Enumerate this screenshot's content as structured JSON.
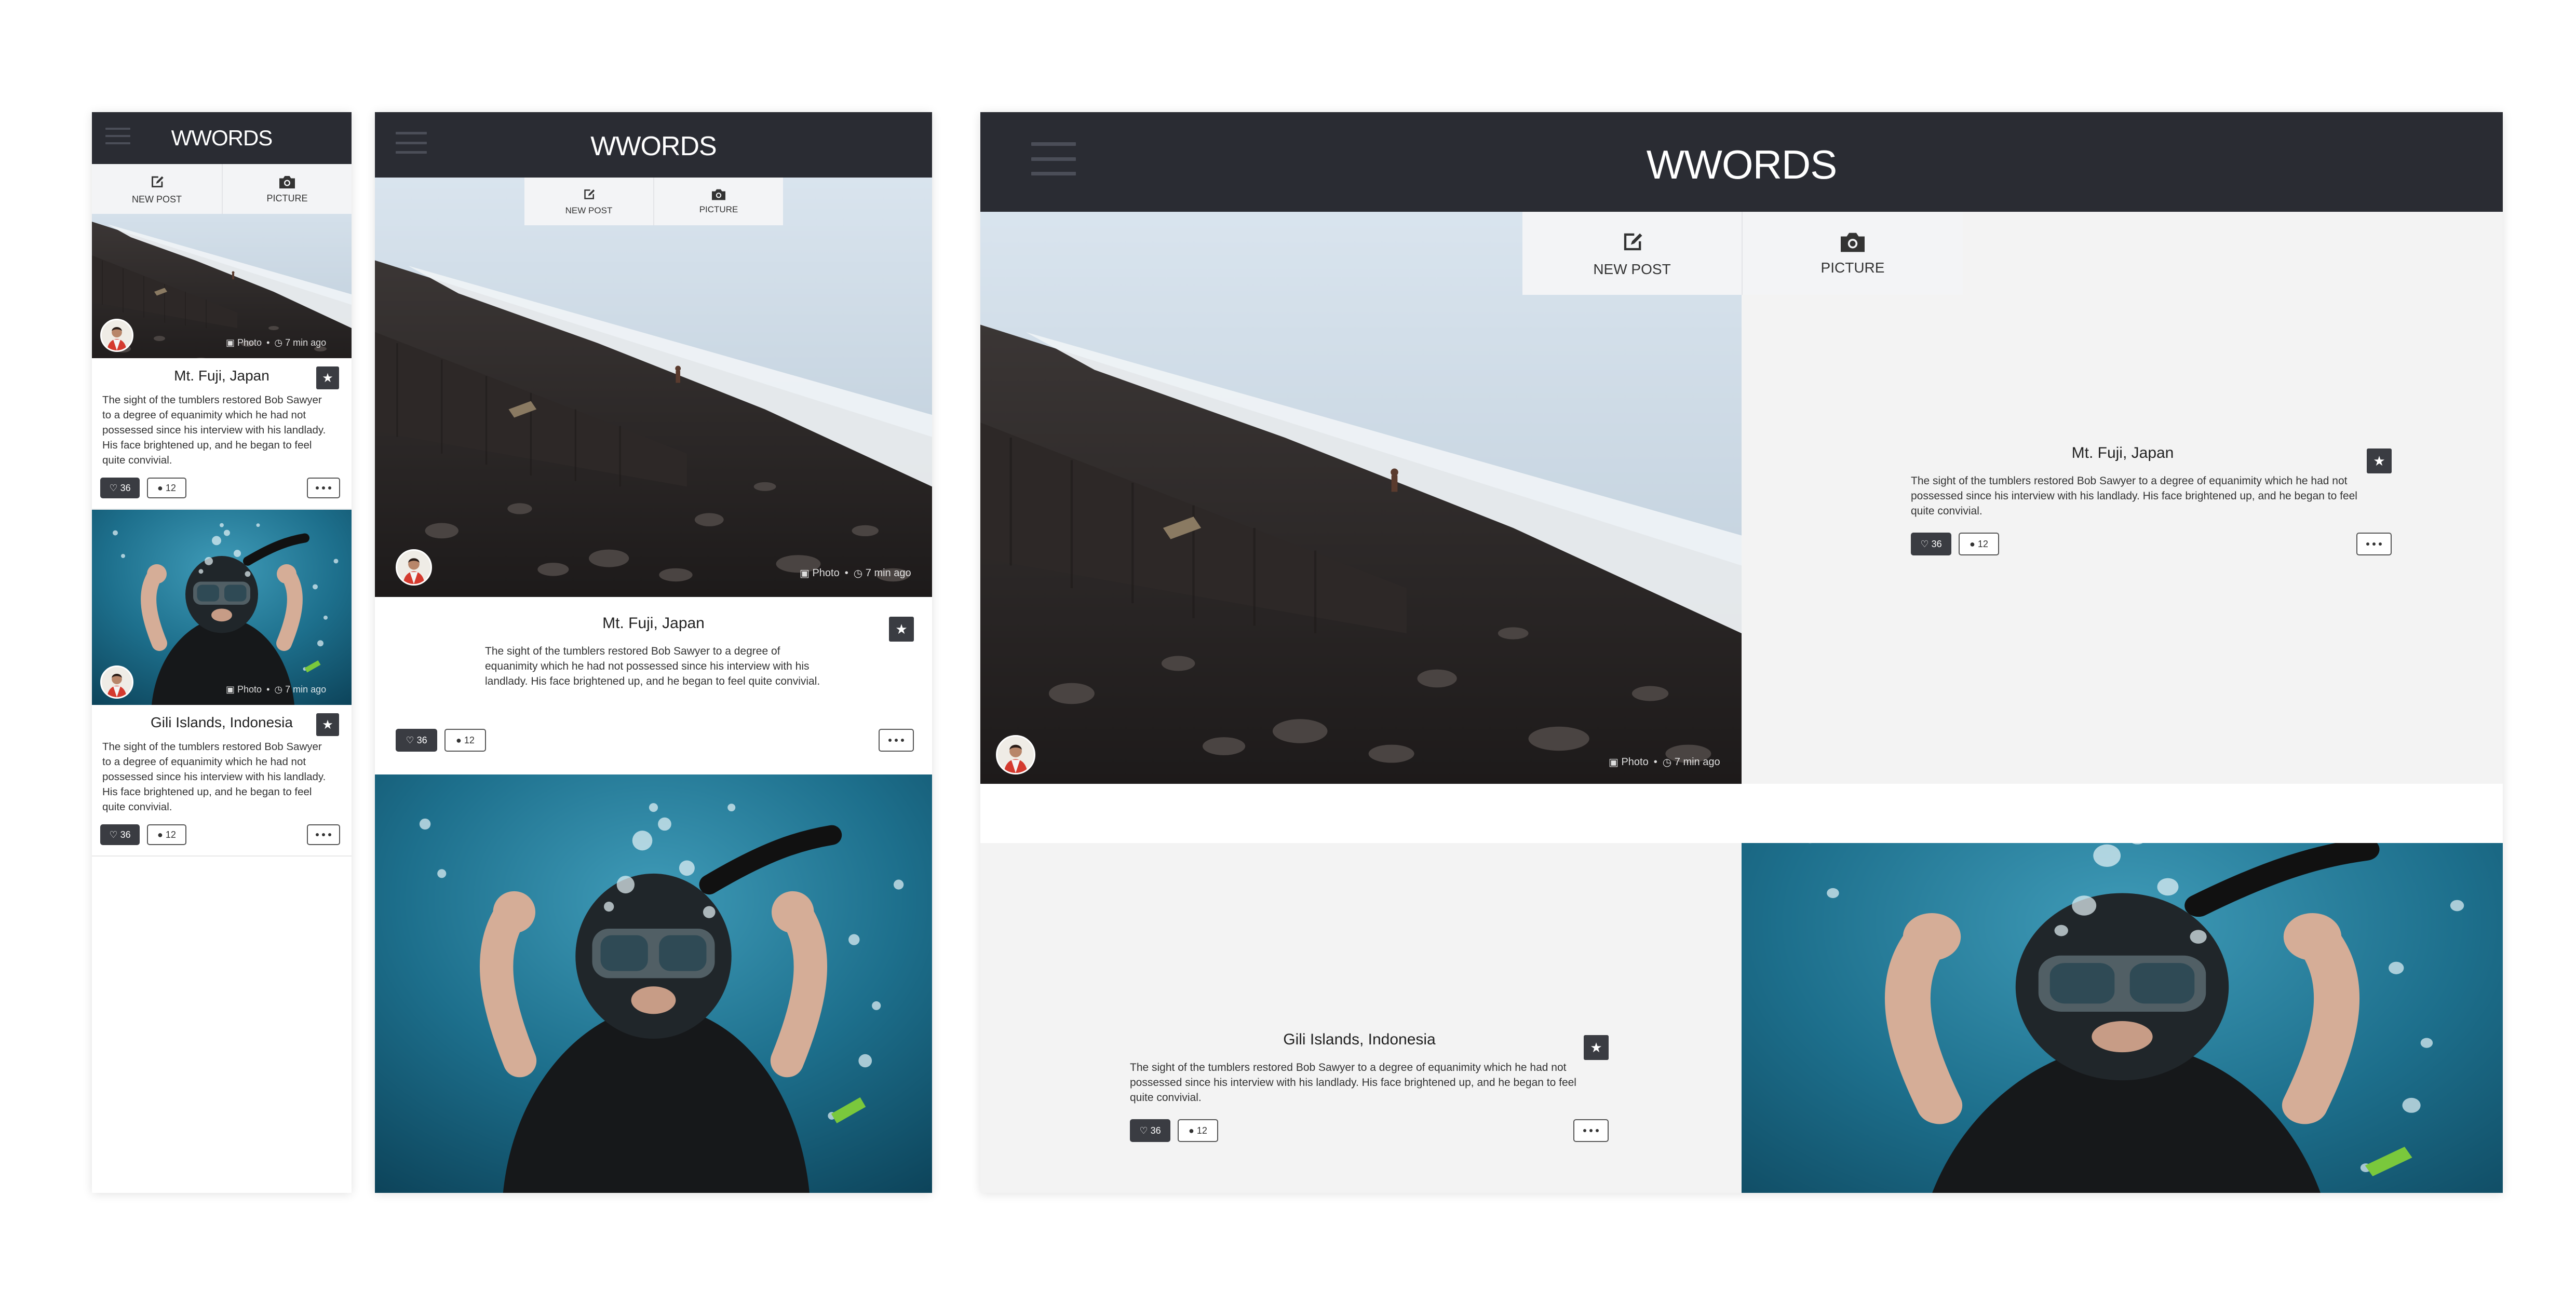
{
  "app": {
    "title": "WWORDS"
  },
  "actions": {
    "new_post": "NEW POST",
    "picture": "PICTURE"
  },
  "posts": [
    {
      "title": "Mt. Fuji, Japan",
      "text": "The sight of the tumblers restored Bob Sawyer to a degree of equanimity which he had not possessed since his interview with his landlady. His face brightened up, and he began to feel quite convivial.",
      "meta_type": "Photo",
      "meta_time": "7 min ago",
      "likes": "36",
      "comments": "12"
    },
    {
      "title": "Gili Islands, Indonesia",
      "text": "The sight of the tumblers restored Bob Sawyer to a degree of equanimity which he had not possessed since his interview with his landlady. His face brightened up, and he began to feel quite convivial.",
      "meta_type": "Photo",
      "meta_time": "7 min ago",
      "likes": "36",
      "comments": "12"
    }
  ],
  "icons": {
    "menu": "hamburger-icon",
    "new_post": "edit-icon",
    "picture": "camera-icon",
    "star": "star-icon",
    "like": "heart-icon",
    "comment": "comment-icon",
    "more": "more-icon",
    "meta": "camera-icon",
    "time": "clock-icon"
  },
  "colors": {
    "appbar": "#2a2c33",
    "accent": "#3a3c42",
    "panel": "#f3f3f3"
  }
}
